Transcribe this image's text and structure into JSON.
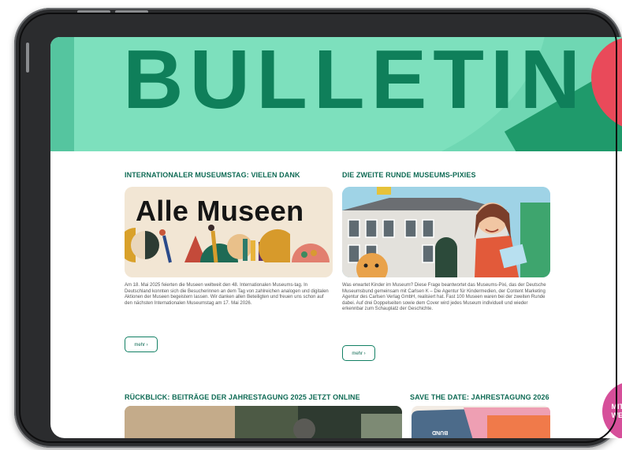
{
  "banner": {
    "title": "BULLETIN"
  },
  "left": {
    "heading": "INTERNATIONALER MUSEUMSTAG: VIELEN DANK",
    "teaser_text": "Alle Museen",
    "body": "Am 18. Mai 2025 feierten die Museen weltweit den 48. Internationalen Museums-tag. In Deutschland konnten sich die Besucherinnen an dem Tag von zahlreichen analogen und digitalen Aktionen der Museen begeistern lassen. Wir danken allen Beteiligten und freuen uns schon auf den nächsten Internationalen Museumstag am 17. Mai 2026.",
    "more": "mehr ›"
  },
  "right": {
    "heading": "DIE ZWEITE RUNDE MUSEUMS-PIXIES",
    "body": "Was erwartet Kinder im Museum? Diese Frage beantwortet das Museums-Pixi, das der Deutsche Museumsbund gemeinsam mit Carlsen K – Die Agentur für Kindermedien, der Content Marketing Agentur des Carlsen Verlag GmbH, realisiert hat. Fast 100 Museen waren bei der zweiten Runde dabei. Auf drei Doppelseiten sowie dem Cover wird jedes Museum individuell und wieder erkennbar zum Schauplatz der Geschichte.",
    "more": "mehr ›"
  },
  "bottom": {
    "left_heading": "RÜCKBLICK: BEITRÄGE DER JAHRESTAGUNG 2025 JETZT ONLINE",
    "right_heading": "SAVE THE DATE: JAHRESTAGUNG 2026",
    "right_img_text": "BUND"
  },
  "badge": {
    "line1": "MITGLIED",
    "line2": "WERDEN!"
  }
}
